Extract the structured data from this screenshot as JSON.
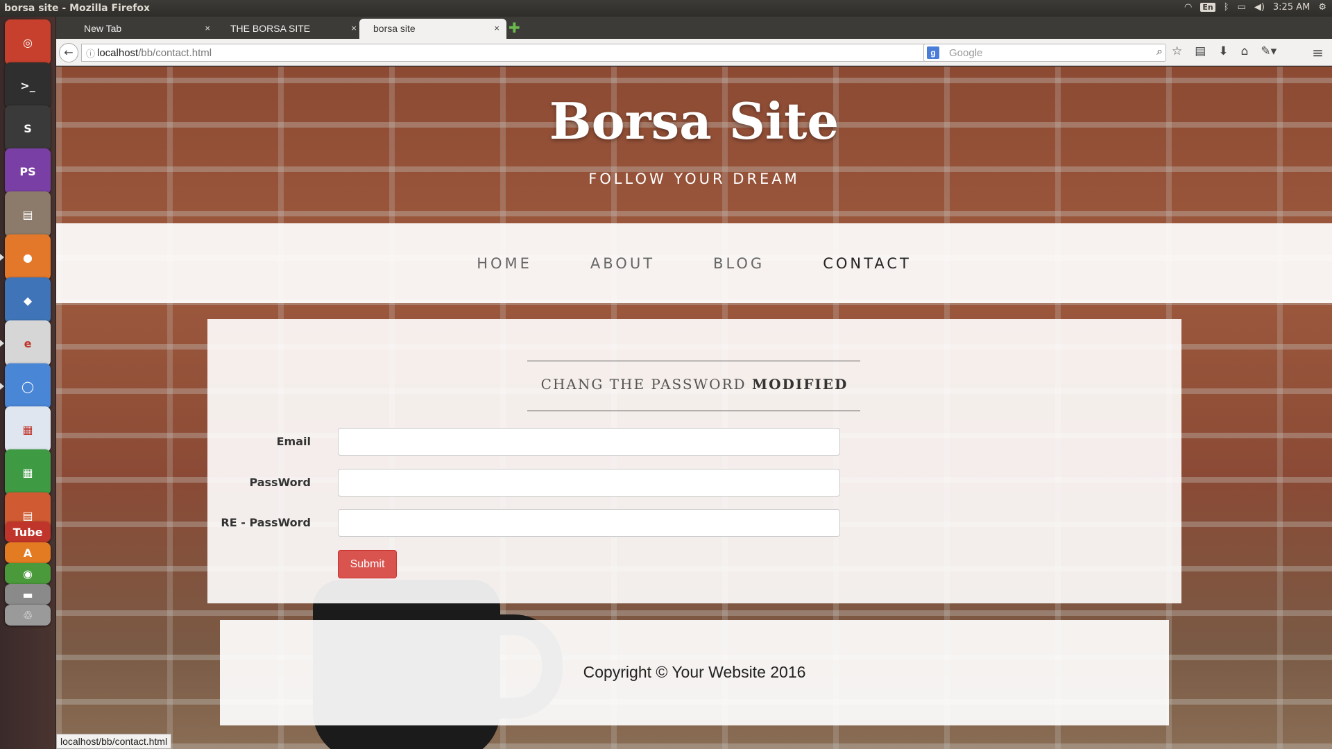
{
  "panel": {
    "window_title": "borsa site - Mozilla Firefox",
    "kbd_layout": "En",
    "clock": "3:25 AM"
  },
  "launcher": {
    "items": [
      {
        "name": "ubuntu-dash-icon",
        "glyph": "◎",
        "bg": "#c6402d"
      },
      {
        "name": "terminal-icon",
        "glyph": ">_",
        "bg": "#2f2f2f"
      },
      {
        "name": "sublime-text-icon",
        "glyph": "S",
        "bg": "#3a3a3a"
      },
      {
        "name": "phpstorm-icon",
        "glyph": "PS",
        "bg": "#7a3fa5"
      },
      {
        "name": "files-icon",
        "glyph": "▤",
        "bg": "#8c7b6a"
      },
      {
        "name": "firefox-icon",
        "glyph": "●",
        "bg": "#e3782b"
      },
      {
        "name": "virtualbox-icon",
        "glyph": "◆",
        "bg": "#3f74b8"
      },
      {
        "name": "evince-icon",
        "glyph": "e",
        "bg": "#d6d6d6"
      },
      {
        "name": "chromium-icon",
        "glyph": "◯",
        "bg": "#4a86d6"
      },
      {
        "name": "writer-icon",
        "glyph": "▦",
        "bg": "#dfe6ef"
      },
      {
        "name": "calc-icon",
        "glyph": "▦",
        "bg": "#3e9b44"
      },
      {
        "name": "impress-icon",
        "glyph": "▤",
        "bg": "#d05a31"
      },
      {
        "name": "youtube-icon",
        "glyph": "Tube",
        "bg": "#c0352b"
      },
      {
        "name": "software-center-icon",
        "glyph": "A",
        "bg": "#e27b22"
      },
      {
        "name": "app-icon",
        "glyph": "◉",
        "bg": "#4a9a3b"
      },
      {
        "name": "drive-icon",
        "glyph": "▬",
        "bg": "#8a8a8a"
      },
      {
        "name": "trash-icon",
        "glyph": "♲",
        "bg": "#9a9a9a"
      }
    ]
  },
  "tabs": [
    {
      "label": "New Tab",
      "close": "×"
    },
    {
      "label": "THE BORSA SITE",
      "close": "×"
    },
    {
      "label": "borsa site",
      "close": "×"
    }
  ],
  "newtab": "✚",
  "urlbar": {
    "host": "localhost",
    "path": "/bb/contact.html",
    "controls": "▾ ↻"
  },
  "search": {
    "placeholder": "Google",
    "engine": "g"
  },
  "site": {
    "brand": "Borsa Site",
    "tagline": "FOLLOW YOUR DREAM",
    "nav": [
      "HOME",
      "ABOUT",
      "BLOG",
      "CONTACT"
    ],
    "active_nav": "CONTACT"
  },
  "form": {
    "title_light": "CHANG THE PASSWORD",
    "title_bold": "MODIFIED",
    "fields": [
      {
        "label": "Email",
        "value": ""
      },
      {
        "label": "PassWord",
        "value": ""
      },
      {
        "label": "RE - PassWord",
        "value": ""
      }
    ],
    "submit": "Submit"
  },
  "footer": {
    "copyright": "Copyright © Your Website 2016"
  },
  "statusbar": {
    "url": "localhost/bb/contact.html"
  }
}
